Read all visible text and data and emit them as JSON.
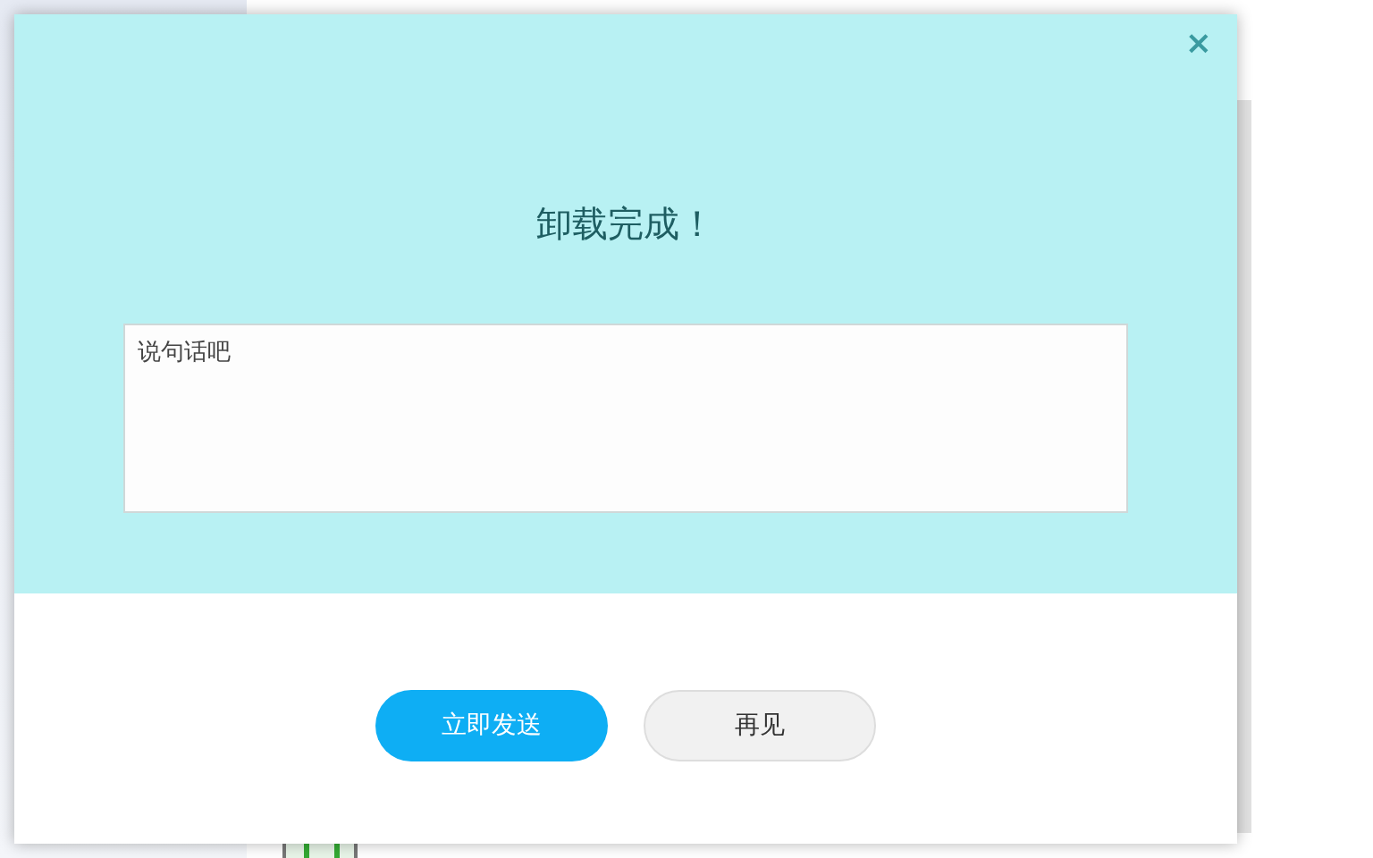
{
  "dialog": {
    "title": "卸载完成！",
    "close": "×",
    "comment": {
      "placeholder": "说句话吧"
    },
    "buttons": [
      {
        "label": "立即发送",
        "kind": "primary"
      },
      {
        "label": "再见",
        "kind": "secondary"
      }
    ]
  }
}
